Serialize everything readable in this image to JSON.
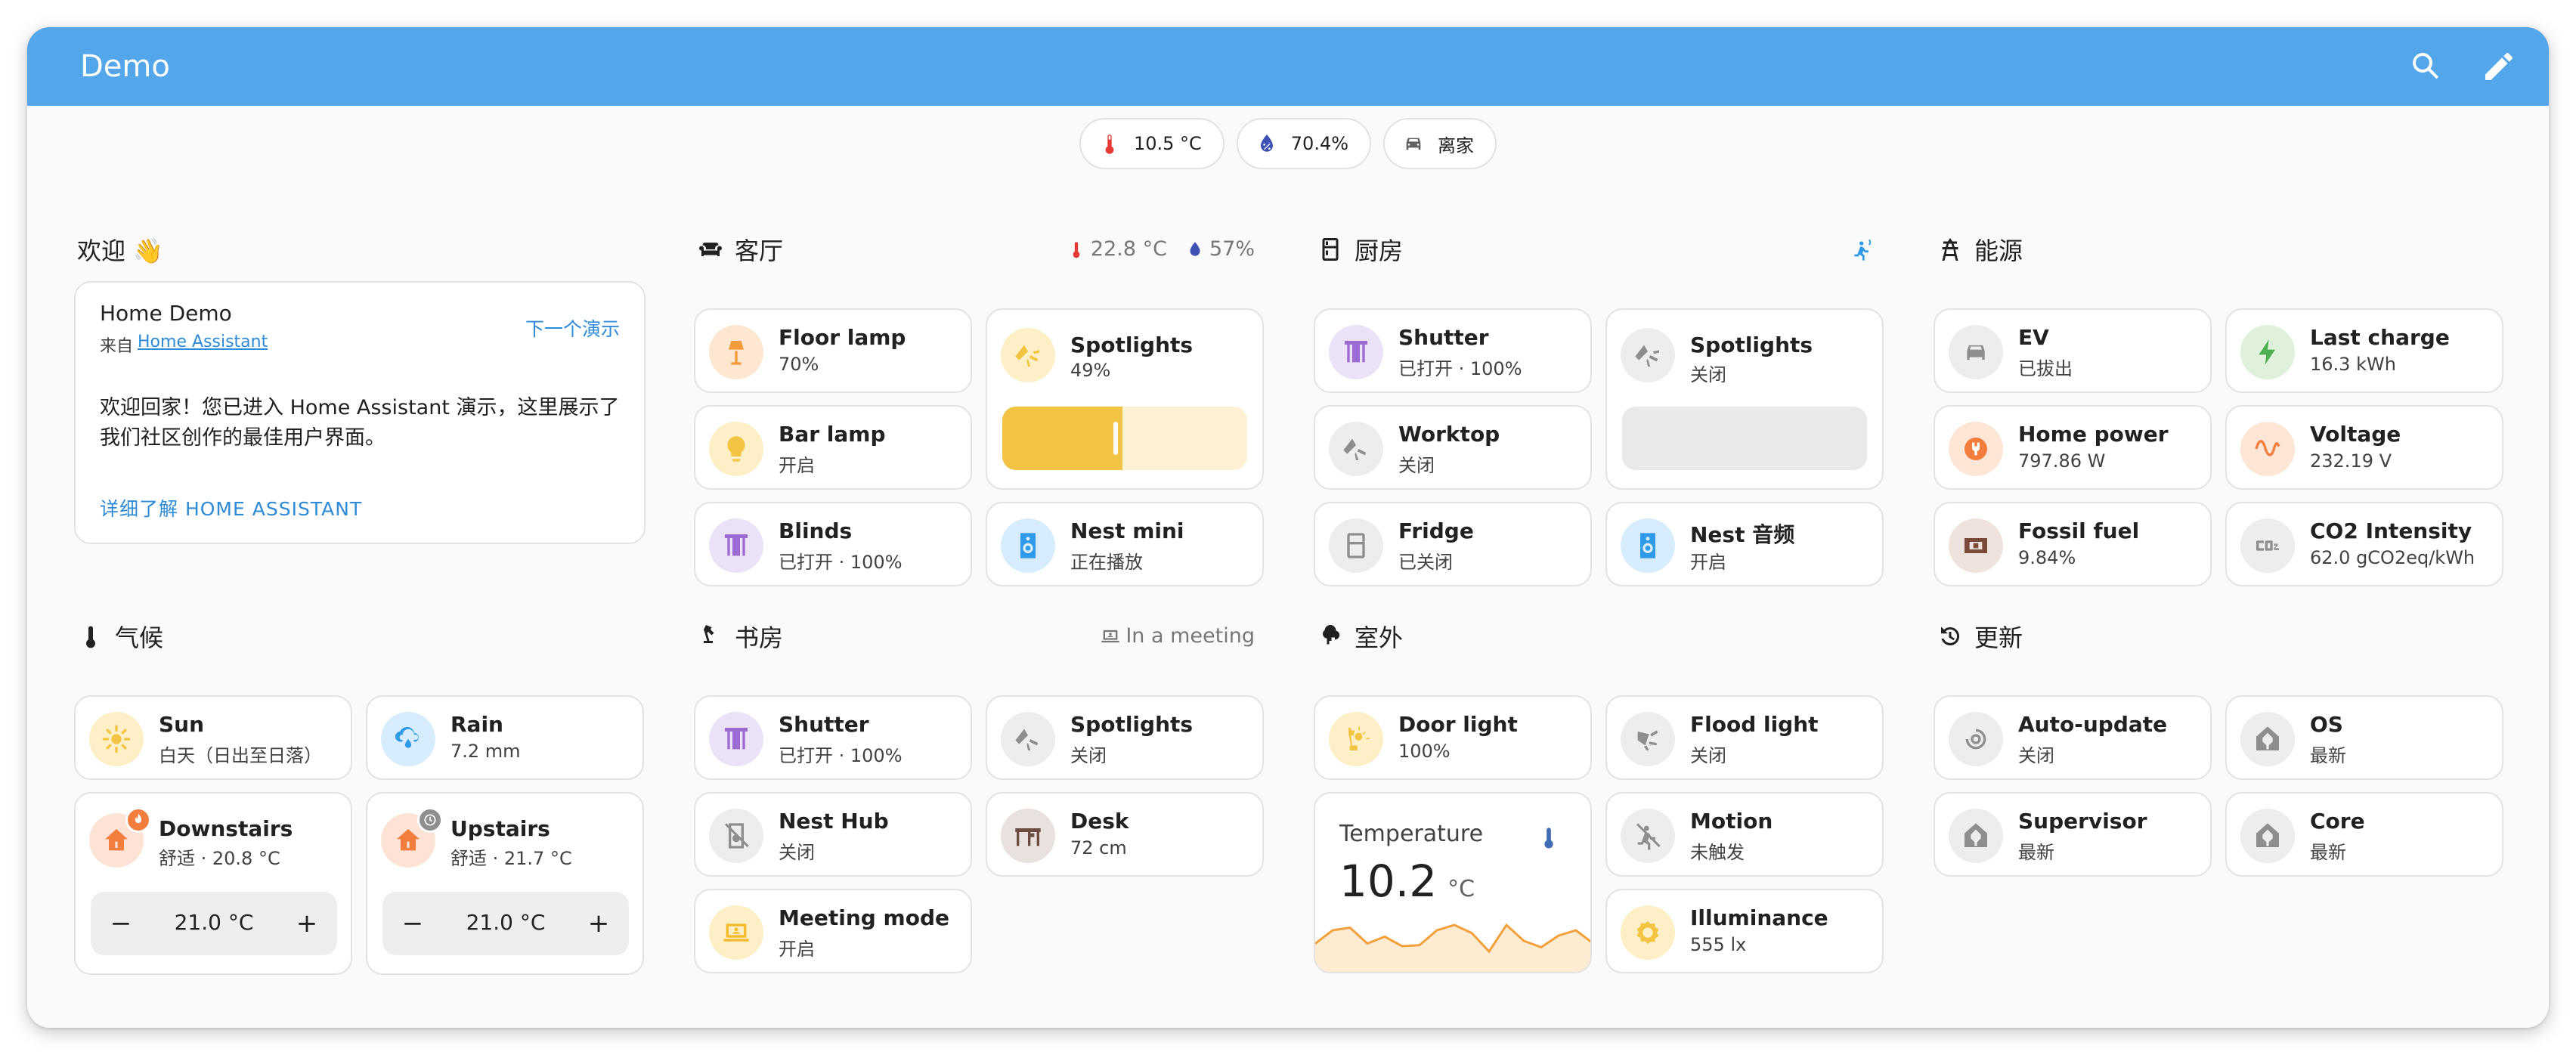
{
  "app": {
    "title": "Demo"
  },
  "badges": [
    {
      "value": "10.5 °C"
    },
    {
      "value": "70.4%"
    },
    {
      "value": "离家"
    }
  ],
  "welcome": {
    "section_title": "欢迎 👋",
    "title": "Home Demo",
    "from": "来自",
    "link": "Home Assistant",
    "next": "下一个演示",
    "body": "欢迎回家！您已进入 Home Assistant 演示，这里展示了我们社区创作的最佳用户界面。",
    "learn": "详细了解 HOME ASSISTANT"
  },
  "living": {
    "title": "客厅",
    "temp": "22.8 °C",
    "humidity": "57%",
    "tiles": [
      {
        "name": "Floor lamp",
        "state": "70%"
      },
      {
        "name": "Spotlights",
        "state": "49%"
      },
      {
        "name": "Bar lamp",
        "state": "开启"
      },
      {
        "name": "Blinds",
        "state": "已打开 · 100%"
      },
      {
        "name": "Nest mini",
        "state": "正在播放"
      }
    ],
    "spotlight_brightness": 0.49
  },
  "kitchen": {
    "title": "厨房",
    "tiles": [
      {
        "name": "Shutter",
        "state": "已打开 · 100%"
      },
      {
        "name": "Spotlights",
        "state": "关闭"
      },
      {
        "name": "Worktop",
        "state": "关闭"
      },
      {
        "name": "Fridge",
        "state": "已关闭"
      },
      {
        "name": "Nest 音频",
        "state": "开启"
      }
    ]
  },
  "energy": {
    "title": "能源",
    "tiles": [
      {
        "name": "EV",
        "state": "已拔出"
      },
      {
        "name": "Last charge",
        "state": "16.3 kWh"
      },
      {
        "name": "Home power",
        "state": "797.86 W"
      },
      {
        "name": "Voltage",
        "state": "232.19 V"
      },
      {
        "name": "Fossil fuel",
        "state": "9.84%"
      },
      {
        "name": "CO2 Intensity",
        "state": "62.0 gCO2eq/kWh"
      }
    ]
  },
  "climate": {
    "title": "气候",
    "tiles": [
      {
        "name": "Sun",
        "state": "白天（日出至日落）"
      },
      {
        "name": "Rain",
        "state": "7.2 mm"
      },
      {
        "name": "Downstairs",
        "state": "舒适 · 20.8 °C",
        "target": "21.0 °C"
      },
      {
        "name": "Upstairs",
        "state": "舒适 · 21.7 °C",
        "target": "21.0 °C"
      }
    ]
  },
  "study": {
    "title": "书房",
    "status": "In a meeting",
    "tiles": [
      {
        "name": "Shutter",
        "state": "已打开 · 100%"
      },
      {
        "name": "Spotlights",
        "state": "关闭"
      },
      {
        "name": "Nest Hub",
        "state": "关闭"
      },
      {
        "name": "Desk",
        "state": "72 cm"
      },
      {
        "name": "Meeting mode",
        "state": "开启"
      }
    ]
  },
  "outdoor": {
    "title": "室外",
    "tiles": [
      {
        "name": "Door light",
        "state": "100%"
      },
      {
        "name": "Flood light",
        "state": "关闭"
      },
      {
        "name": "Motion",
        "state": "未触发"
      },
      {
        "name": "Illuminance",
        "state": "555 lx"
      }
    ],
    "temperature": {
      "label": "Temperature",
      "value": "10.2",
      "unit": "°C",
      "history": [
        0.55,
        0.3,
        0.25,
        0.55,
        0.42,
        0.6,
        0.58,
        0.3,
        0.2,
        0.35,
        0.7,
        0.2,
        0.5,
        0.62,
        0.4,
        0.3,
        0.55
      ]
    }
  },
  "updates": {
    "title": "更新",
    "tiles": [
      {
        "name": "Auto-update",
        "state": "关闭"
      },
      {
        "name": "OS",
        "state": "最新"
      },
      {
        "name": "Supervisor",
        "state": "最新"
      },
      {
        "name": "Core",
        "state": "最新"
      }
    ]
  },
  "colors": {
    "header": "#53a6ea",
    "accent": "#03a9f4",
    "amber": "#ffc107",
    "orange": "#ff9800",
    "purple": "#9c6cd4"
  }
}
